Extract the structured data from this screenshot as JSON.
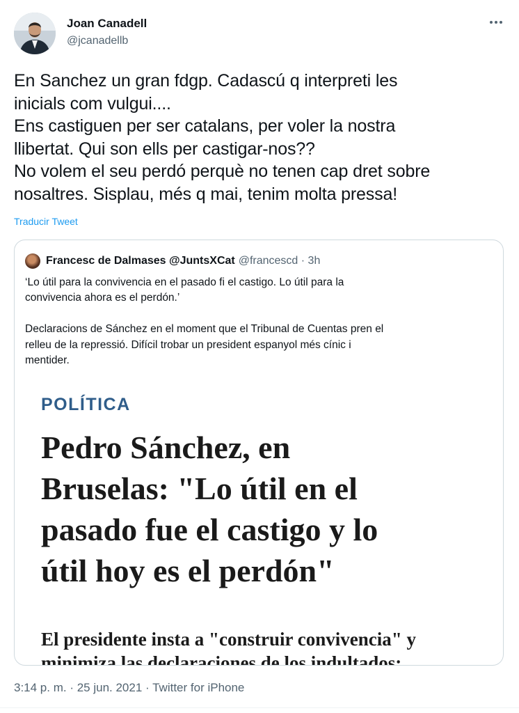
{
  "author": {
    "name": "Joan Canadell",
    "handle": "@jcanadellb"
  },
  "tweet": {
    "text": "En Sanchez un gran fdgp. Cadascú q interpreti les\ninicials com vulgui....\nEns castiguen per ser catalans, per voler la nostra\nllibertat. Qui son ells per castigar-nos??\nNo volem el seu perdó perquè no tenen cap dret sobre\nnosaltres. Sisplau, més q mai, tenim molta pressa!",
    "translate_label": "Traducir Tweet",
    "timestamp": "3:14 p. m. · 25 jun. 2021",
    "separator": " · ",
    "source": "Twitter for iPhone"
  },
  "quoted": {
    "name": "Francesc de Dalmases @JuntsXCat",
    "handle_time": "@francescd · 3h",
    "text": "‘Lo útil para la convivencia en el pasado fi el castigo. Lo útil para la\nconvivencia ahora es el perdón.’\n\nDeclaracions de Sánchez en el moment que el Tribunal de Cuentas pren el\nrelleu de la repressió. Difícil trobar un president espanyol més cínic i\nmentider.",
    "article": {
      "section": "POLÍTICA",
      "headline": "Pedro Sánchez, en\nBruselas: \"Lo útil en el\npasado fue el castigo y lo\nútil hoy es el perdón\"",
      "subhead": "El presidente insta a \"construir convivencia\" y\nminimiza las declaraciones de los indultados:"
    }
  },
  "icons": {
    "more": "more-horizontal-icon"
  },
  "colors": {
    "link": "#1d9bf0",
    "secondary": "#536471",
    "section": "#2f5d8a"
  }
}
